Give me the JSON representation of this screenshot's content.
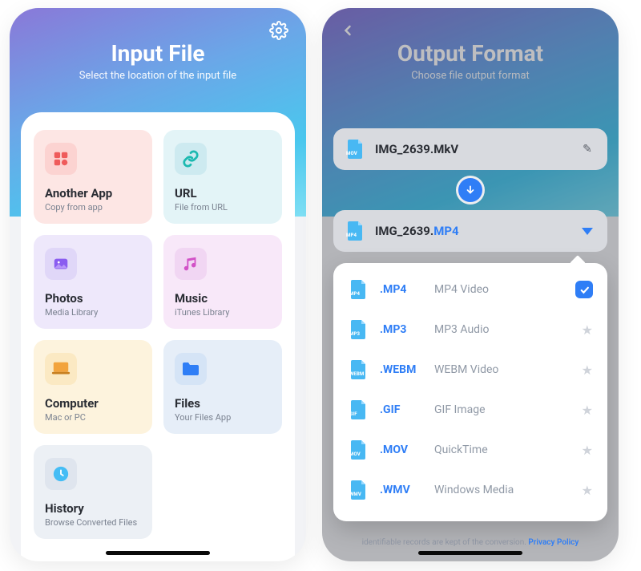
{
  "left": {
    "title": "Input File",
    "subtitle": "Select the location of the input file",
    "tiles": {
      "another_app": {
        "title": "Another App",
        "sub": "Copy from app"
      },
      "url": {
        "title": "URL",
        "sub": "File from URL"
      },
      "photos": {
        "title": "Photos",
        "sub": "Media Library"
      },
      "music": {
        "title": "Music",
        "sub": "iTunes Library"
      },
      "computer": {
        "title": "Computer",
        "sub": "Mac or PC"
      },
      "files": {
        "title": "Files",
        "sub": "Your Files App"
      },
      "history": {
        "title": "History",
        "sub": "Browse Converted Files"
      }
    }
  },
  "right": {
    "title": "Output Format",
    "subtitle": "Choose file output format",
    "input_file": {
      "badge": "MOV",
      "name": "IMG_2639.MkV"
    },
    "output_file": {
      "badge": "MP4",
      "name_base": "IMG_2639.",
      "name_ext": "MP4"
    },
    "formats": [
      {
        "badge": "MP4",
        "ext": ".MP4",
        "name": "MP4 Video",
        "selected": true
      },
      {
        "badge": "MP3",
        "ext": ".MP3",
        "name": "MP3 Audio",
        "selected": false
      },
      {
        "badge": "WEBM",
        "ext": ".WEBM",
        "name": "WEBM Video",
        "selected": false
      },
      {
        "badge": "GIF",
        "ext": ".GIF",
        "name": "GIF Image",
        "selected": false
      },
      {
        "badge": "MOV",
        "ext": ".MOV",
        "name": "QuickTime",
        "selected": false
      },
      {
        "badge": "WMV",
        "ext": ".WMV",
        "name": "Windows Media",
        "selected": false
      }
    ],
    "footer_text": "identifiable records are kept of the conversion. ",
    "footer_link": "Privacy Policy",
    "colors": {
      "accent": "#2f7ef6"
    }
  }
}
